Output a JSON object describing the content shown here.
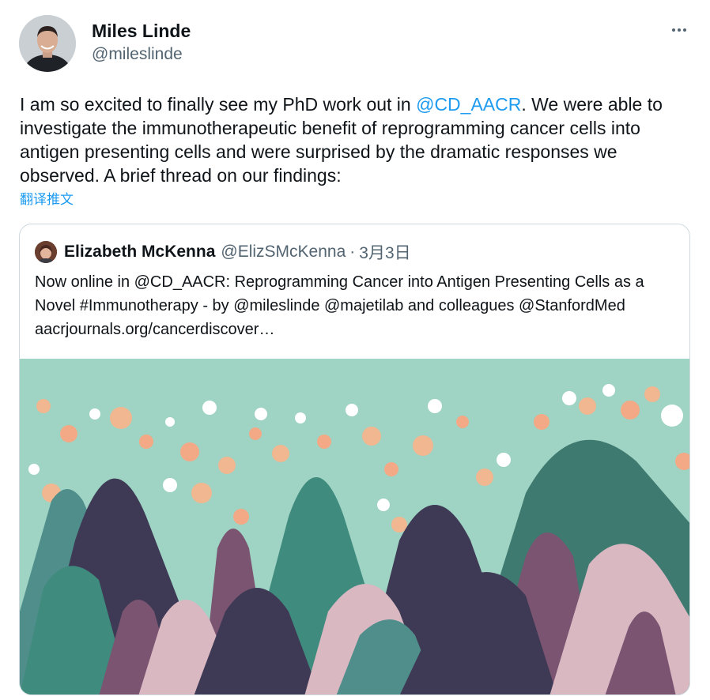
{
  "author": {
    "name": "Miles Linde",
    "handle": "@mileslinde"
  },
  "tweet": {
    "text_before": "I am so excited to finally see my PhD work out in ",
    "mention": "@CD_AACR",
    "text_after": ". We were able to investigate the immunotherapeutic benefit of reprogramming cancer cells into antigen presenting cells and were surprised by the dramatic responses we observed. A brief thread on our findings:",
    "translate_label": "翻译推文"
  },
  "quoted": {
    "name": "Elizabeth McKenna",
    "handle": "@ElizSMcKenna",
    "separator": "·",
    "date": "3月3日",
    "text": "Now online in @CD_AACR: Reprogramming Cancer into Antigen Presenting Cells as a Novel #Immunotherapy - by @mileslinde @majetilab and colleagues @StanfordMed aacrjournals.org/cancerdiscover…"
  },
  "colors": {
    "accent": "#1d9bf0",
    "text": "#0f1419",
    "secondary": "#536471",
    "border": "#cfd9de",
    "media_sky": "#9fd3c4"
  },
  "icons": {
    "more": "more-horizontal-icon"
  }
}
